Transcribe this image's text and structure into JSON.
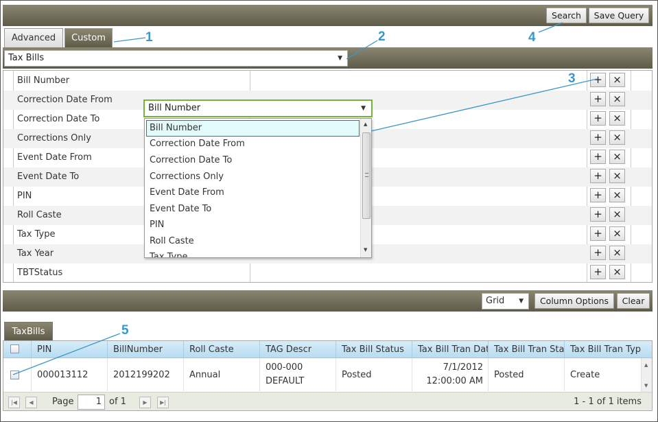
{
  "toolbar": {
    "search_label": "Search",
    "save_query_label": "Save Query"
  },
  "tabs": {
    "advanced": "Advanced",
    "custom": "Custom"
  },
  "entity_select": {
    "value": "Tax Bills"
  },
  "fields": [
    "Bill Number",
    "Correction Date From",
    "Correction Date To",
    "Corrections Only",
    "Event Date From",
    "Event Date To",
    "PIN",
    "Roll Caste",
    "Tax Type",
    "Tax Year",
    "TBTStatus"
  ],
  "field_dropdown": {
    "value": "Bill Number",
    "options": [
      "Bill Number",
      "Correction Date From",
      "Correction Date To",
      "Corrections Only",
      "Event Date From",
      "Event Date To",
      "PIN",
      "Roll Caste",
      "Tax Type"
    ]
  },
  "add_glyph": "+",
  "remove_glyph": "×",
  "results_toolbar": {
    "view_select": "Grid",
    "column_options_label": "Column Options",
    "clear_label": "Clear"
  },
  "results_tab": "TaxBills",
  "grid": {
    "columns": [
      "PIN",
      "BillNumber",
      "Roll Caste",
      "TAG Descr",
      "Tax Bill Status",
      "Tax Bill Tran Date",
      "Tax Bill Tran Status",
      "Tax Bill Tran Type"
    ],
    "row": {
      "pin": "000013112",
      "bill_number": "2012199202",
      "roll_caste": "Annual",
      "tag_descr_line1": "000-000",
      "tag_descr_line2": "DEFAULT",
      "status": "Posted",
      "tran_date_line1": "7/1/2012",
      "tran_date_line2": "12:00:00 AM",
      "tran_status": "Posted",
      "tran_type": "Create"
    }
  },
  "pager": {
    "page_label": "Page",
    "page_value": "1",
    "of_label": "of 1",
    "items_summary": "1 - 1 of 1 items"
  },
  "callouts": [
    "1",
    "2",
    "3",
    "4",
    "5"
  ],
  "colors": {
    "accent_bar": "#6f6b57",
    "callout": "#3c96c8",
    "header_blue": "#c8e4f5",
    "dropdown_focus": "#74b33e"
  }
}
